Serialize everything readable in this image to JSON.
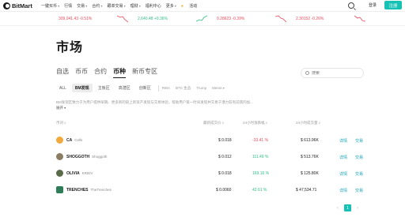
{
  "brand": {
    "name": "BitMart"
  },
  "nav": {
    "items": [
      "一键买币",
      "行情",
      "交易",
      "合约",
      "跟单交易",
      "理财",
      "福利中心",
      "更多",
      "活动"
    ],
    "login": "登录",
    "register": "注册"
  },
  "ticker": [
    {
      "text": "309,041.43 -0.51%",
      "trend": "down"
    },
    {
      "text": "2,640.48 +0.36%",
      "trend": "up"
    },
    {
      "text": "0.28623 -0.39%",
      "trend": "down"
    },
    {
      "text": "2.30152 -0.26%",
      "trend": "down"
    }
  ],
  "page": {
    "title": "市场"
  },
  "main_tabs": [
    "自选",
    "币币",
    "合约",
    "币种",
    "新币专区"
  ],
  "sub_tabs": [
    "ALL",
    "BM发现",
    "主板区",
    "高潜区",
    "创新区"
  ],
  "filters": [
    "RWA",
    "BTC 生态",
    "Trump",
    "Meme"
  ],
  "search": {
    "placeholder": "搜索"
  },
  "description": "BM发现区致力于为用户提供早期、更多新的链上新资产发现与交易体验，帮助用户第一时间发现并交易于潜力较有前景的加...",
  "expand_label": "展开",
  "table": {
    "headers": {
      "name": "币对",
      "price": "最新成交价",
      "change": "24小时涨跌幅",
      "volume": "24小时成交量",
      "actions": ""
    },
    "rows": [
      {
        "symbol": "CA",
        "name": "Cells",
        "price": "$ 0.018",
        "change": "-33.41 %",
        "trend": "down",
        "volume": "$ 613.96K",
        "icon_color": "#f2a93b"
      },
      {
        "symbol": "SHOGGOTH",
        "name": "Shoggoth",
        "price": "$ 0.012",
        "change": "111.49 %",
        "trend": "up",
        "volume": "$ 513.76K",
        "icon_color": "#8a7d62"
      },
      {
        "symbol": "OLIVIA",
        "name": "KRIDV",
        "price": "$ 0.018",
        "change": "169.16 %",
        "trend": "up",
        "volume": "$ 125.80K",
        "icon_color": "#5a6b4a"
      },
      {
        "symbol": "TRENCHES",
        "name": "TheTrenches",
        "price": "$ 0.0060",
        "change": "42.61 %",
        "trend": "up",
        "volume": "$ 47,534.71",
        "icon_color": "#2e7d57"
      }
    ],
    "action_detail": "详情",
    "action_trade": "交易"
  },
  "pagination": {
    "current": "1",
    "prev": "‹",
    "next": "›"
  },
  "colors": {
    "accent": "#17c2b4",
    "up": "#2ebd85",
    "down": "#e84b5d"
  }
}
